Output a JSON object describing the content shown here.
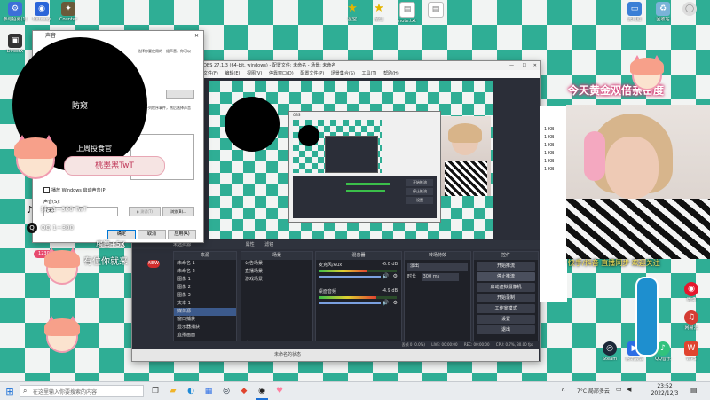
{
  "desktop": {
    "icons_left": [
      {
        "label": "参与招募(1)",
        "icon": "gear-icon",
        "color": "#3d6fd8"
      },
      {
        "label": "Neteasy",
        "icon": "globe-icon",
        "color": "#2b65d9"
      },
      {
        "label": "Counter",
        "icon": "cs-icon",
        "color": "#6a5a3a"
      },
      {
        "label": "DirectX",
        "icon": "app-icon",
        "color": "#333333"
      }
    ],
    "icons_top": [
      {
        "label": "星空",
        "icon": "star-icon",
        "color": "#e5b500"
      },
      {
        "label": "最佳",
        "icon": "star-icon",
        "color": "#e5b500"
      },
      {
        "label": "note.txt",
        "icon": "doc-icon",
        "color": "#ffffff"
      },
      {
        "label": "",
        "icon": "doc-icon",
        "color": "#ffffff"
      }
    ],
    "icons_right": [
      {
        "label": "此电脑",
        "icon": "computer-icon",
        "color": "#3b7fd6"
      },
      {
        "label": "回收站",
        "icon": "recycle-icon",
        "color": "#7ab3d8"
      },
      {
        "label": "",
        "icon": "circle-icon",
        "color": "#dddddd"
      }
    ],
    "icons_bottom_right": [
      {
        "label": "微博",
        "icon": "weibo-icon",
        "color": "#e6162d"
      },
      {
        "label": "网易云",
        "icon": "music-icon",
        "color": "#d43c33"
      },
      {
        "label": "WPS",
        "icon": "wps-icon",
        "color": "#e0442f"
      },
      {
        "label": "Steam",
        "icon": "steam-icon",
        "color": "#1b2838"
      },
      {
        "label": "腾讯会议",
        "icon": "meeting-icon",
        "color": "#2b6de5"
      },
      {
        "label": "QQ音乐",
        "icon": "qq-icon",
        "color": "#31c27c"
      }
    ]
  },
  "overlay": {
    "circle_text": "防窥",
    "banner_title": "上周投食官",
    "banner_name": "桃墨黑TwT",
    "tiktok_text": "抖~1~300 TwT",
    "qq_text": "QQ 1~300",
    "gift_text": "房管+5X",
    "welcome_text": "有位你就来",
    "fans_badge": "12300",
    "new_badge": "NEW"
  },
  "stream": {
    "top_banner": "今天黄金双倍亲密度",
    "bottom_banner": "快手/抖音 直播同步 欢迎关注",
    "file_sizes": [
      "1 KB",
      "1 KB",
      "1 KB",
      "1 KB",
      "1 KB",
      "1 KB"
    ]
  },
  "sound_dialog": {
    "title": "声音",
    "close": "✕",
    "desc": "选择你要使用的一组声音。你可以",
    "desc2": "选择下列程序事件，然后选择声音",
    "label_events": "程序事件:",
    "checkbox_label": "播放 Windows 启动声音(P)",
    "sounds_label": "声音(S):",
    "sound_value": "(无)",
    "test_button": "▶ 测试(T)",
    "browse_button": "浏览(B)...",
    "ok": "确定",
    "cancel": "取消",
    "apply": "应用(A)"
  },
  "obs": {
    "title": "OBS 27.1.3 (64-bit, windows) - 配置文件: 未命名 - 场景: 未命名",
    "menu": [
      "文件(F)",
      "编辑(E)",
      "视图(V)",
      "停靠窗口(D)",
      "配置文件(P)",
      "场景集合(S)",
      "工具(T)",
      "帮助(H)"
    ],
    "mini_tabs": [
      "属性",
      "滤镜"
    ],
    "status_left": "未选择源",
    "panels": {
      "sources_title": "来源",
      "scenes_title": "场景",
      "mixer_title": "混音器",
      "transitions_title": "转场特效",
      "controls_title": "控件"
    },
    "sources": [
      "未命名 1",
      "未命名 2",
      "图像 1",
      "图像 2",
      "图像 3",
      "文本 1",
      "媒体源",
      "窗口捕获",
      "显示器捕获",
      "直播画面"
    ],
    "scenes": [
      "公告场景",
      "直播场景",
      "游戏场景"
    ],
    "mixer": [
      {
        "name": "麦克风/Aux",
        "db": "-6.0 dB",
        "fill": 0.62
      },
      {
        "name": "桌面音频",
        "db": "-4.9 dB",
        "fill": 0.74
      }
    ],
    "transition": {
      "type": "淡出",
      "duration_label": "时长",
      "duration": "300 ms"
    },
    "controls": [
      "开始推流",
      "停止推流",
      "启动虚拟摄像机",
      "开始录制",
      "工作室模式",
      "设置",
      "退出"
    ],
    "status_bar": [
      "丢帧 0 (0.0%)",
      "LIVE: 00:00:00",
      "REC: 00:00:00",
      "CPU: 0.7%, 30.00 fps"
    ],
    "taskbar_label": "未命名的状态"
  },
  "nested": {
    "title": "OBS",
    "inner_buttons": [
      "开始推流",
      "停止推流",
      "设置"
    ]
  },
  "taskbar": {
    "start_icon": "windows-icon",
    "search_placeholder": "在这里输入你要搜索的内容",
    "pinned": [
      {
        "icon": "task-view-icon",
        "color": "#555555"
      },
      {
        "icon": "folder-icon",
        "color": "#f0b429"
      },
      {
        "icon": "edge-icon",
        "color": "#1f8ad6"
      },
      {
        "icon": "store-icon",
        "color": "#2b6de5"
      },
      {
        "icon": "steam-icon",
        "color": "#1b2838"
      },
      {
        "icon": "game-icon",
        "color": "#e0442f"
      },
      {
        "icon": "obs-icon",
        "color": "#222222"
      },
      {
        "icon": "cat-icon",
        "color": "#ff7f9f"
      }
    ],
    "tray_weather": "7°C 局部多云",
    "time": "23:52",
    "date": "2022/12/3"
  }
}
